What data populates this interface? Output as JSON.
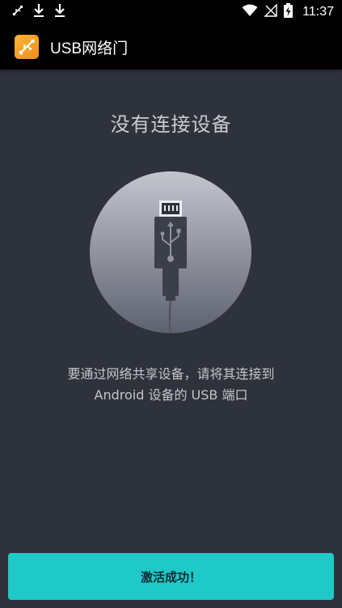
{
  "status_bar": {
    "time": "11:37",
    "left_icons": [
      "usb-debug-icon",
      "download-icon",
      "download-icon"
    ],
    "right_icons": [
      "wifi-icon",
      "no-sim-icon",
      "battery-charging-icon"
    ]
  },
  "app_bar": {
    "title": "USB网络门",
    "icon": "usb-app-icon",
    "icon_color": "#f59f2a"
  },
  "main": {
    "heading": "没有连接设备",
    "illustration": "usb-cable-icon",
    "description_line1": "要通过网络共享设备，请将其连接到",
    "description_line2": "Android 设备的 USB 端口"
  },
  "action_button": {
    "label": "激活成功！",
    "color": "#1ec9c8"
  }
}
